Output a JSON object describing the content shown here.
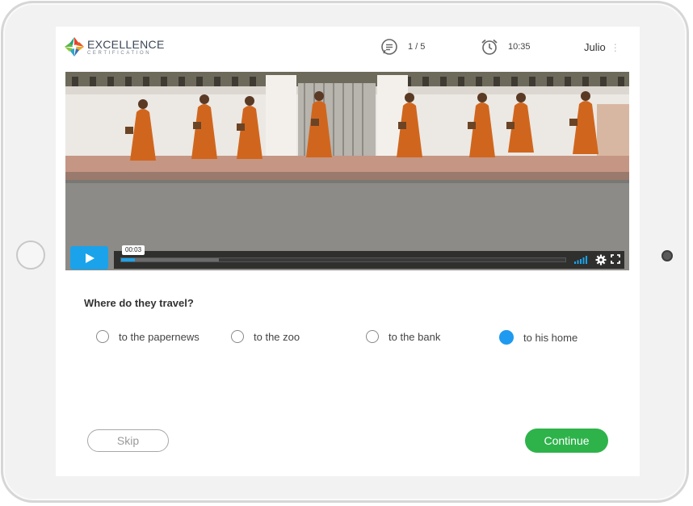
{
  "brand": {
    "name": "EXCELLENCE",
    "tagline": "CERTIFICATION"
  },
  "header": {
    "progress": "1 / 5",
    "timer": "10:35",
    "user": "Julio",
    "progress_icon": "chat-list-icon",
    "timer_icon": "alarm-clock-icon"
  },
  "video": {
    "current_time": "00:03",
    "played_fraction": 0.03,
    "buffered_fraction": 0.22
  },
  "question": {
    "text": "Where do they travel?",
    "options": [
      {
        "label": "to the papernews",
        "selected": false
      },
      {
        "label": "to the zoo",
        "selected": false
      },
      {
        "label": "to the bank",
        "selected": false
      },
      {
        "label": "to his home",
        "selected": true
      }
    ]
  },
  "actions": {
    "skip": "Skip",
    "continue": "Continue"
  },
  "colors": {
    "accent": "#1aa3ea",
    "radio_selected": "#1e9af0",
    "continue": "#2eb34b"
  }
}
